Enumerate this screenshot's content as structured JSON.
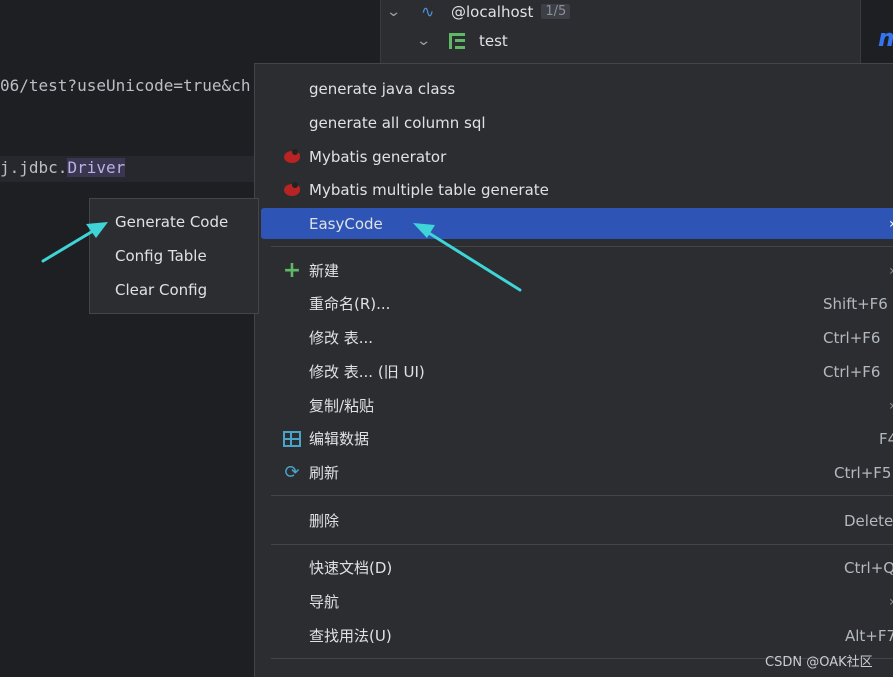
{
  "editor": {
    "line1": "06/test?useUnicode=true&ch",
    "line2_prefix": "j.jdbc.",
    "line2_highlight": "Driver"
  },
  "tree": {
    "host": "@localhost",
    "host_count": "1/5",
    "schema": "test",
    "logo_glyph": "m"
  },
  "menu": {
    "items": [
      {
        "label": "generate java class"
      },
      {
        "label": "generate all column sql"
      },
      {
        "label": "Mybatis generator",
        "icon": "mybatis-bird-icon"
      },
      {
        "label": "Mybatis multiple table generate",
        "icon": "mybatis-bird-icon"
      },
      {
        "label": "EasyCode",
        "arrow": "›"
      },
      {
        "label": "新建",
        "icon": "plus-icon",
        "arrow": "›"
      },
      {
        "label": "重命名(R)...",
        "shortcut": "Shift+F6"
      },
      {
        "label": "修改 表...",
        "shortcut": "Ctrl+F6"
      },
      {
        "label": "修改 表... (旧 UI)",
        "shortcut": "Ctrl+F6"
      },
      {
        "label": "复制/粘贴",
        "arrow": "›"
      },
      {
        "label": "编辑数据",
        "icon": "table-grid-icon",
        "shortcut": "F4"
      },
      {
        "label": "刷新",
        "icon": "refresh-icon",
        "shortcut": "Ctrl+F5"
      },
      {
        "label": "删除",
        "shortcut": "Delete"
      },
      {
        "label": "快速文档(D)",
        "shortcut": "Ctrl+Q"
      },
      {
        "label": "导航",
        "arrow": "›"
      },
      {
        "label": "查找用法(U)",
        "shortcut": "Alt+F7"
      }
    ]
  },
  "submenu": {
    "items": [
      {
        "label": "Generate Code"
      },
      {
        "label": "Config Table"
      },
      {
        "label": "Clear Config"
      }
    ]
  },
  "watermark": "CSDN @OAK社区",
  "colors": {
    "selection": "#2e55b6",
    "annotation_arrow": "#3fd4d8",
    "background": "#1e1f22",
    "menu_bg": "#2b2d30"
  }
}
